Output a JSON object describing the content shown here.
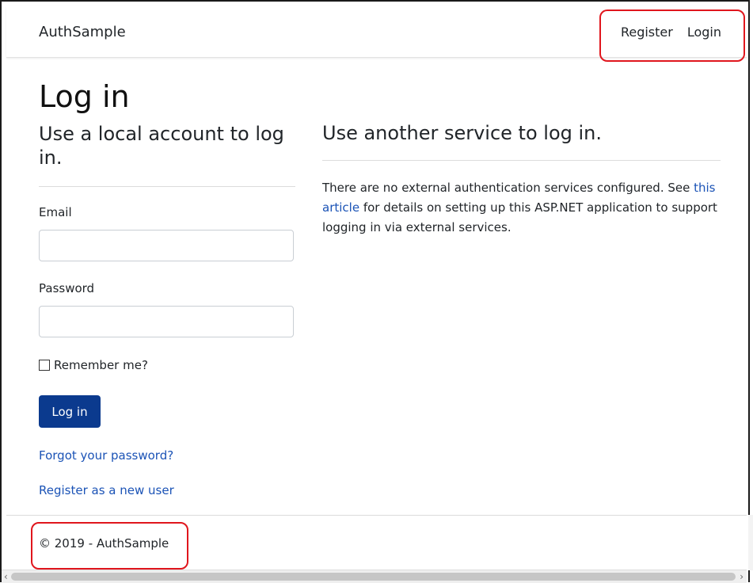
{
  "nav": {
    "brand": "AuthSample",
    "register": "Register",
    "login": "Login"
  },
  "page": {
    "title": "Log in",
    "left_heading": "Use a local account to log in.",
    "right_heading": "Use another service to log in."
  },
  "form": {
    "email_label": "Email",
    "email_value": "",
    "email_placeholder": "",
    "password_label": "Password",
    "password_value": "",
    "password_placeholder": "",
    "remember_label": "Remember me?",
    "submit_label": "Log in",
    "forgot_link": "Forgot your password?",
    "register_link": "Register as a new user"
  },
  "external": {
    "text_before": "There are no external authentication services configured. See ",
    "link_text": "this article",
    "text_after": " for details on setting up this ASP.NET application to support logging in via external services."
  },
  "footer": {
    "text": "© 2019 - AuthSample"
  },
  "colors": {
    "accent": "#0b3a8e",
    "link": "#1b53b6",
    "highlight": "#e0161d"
  }
}
